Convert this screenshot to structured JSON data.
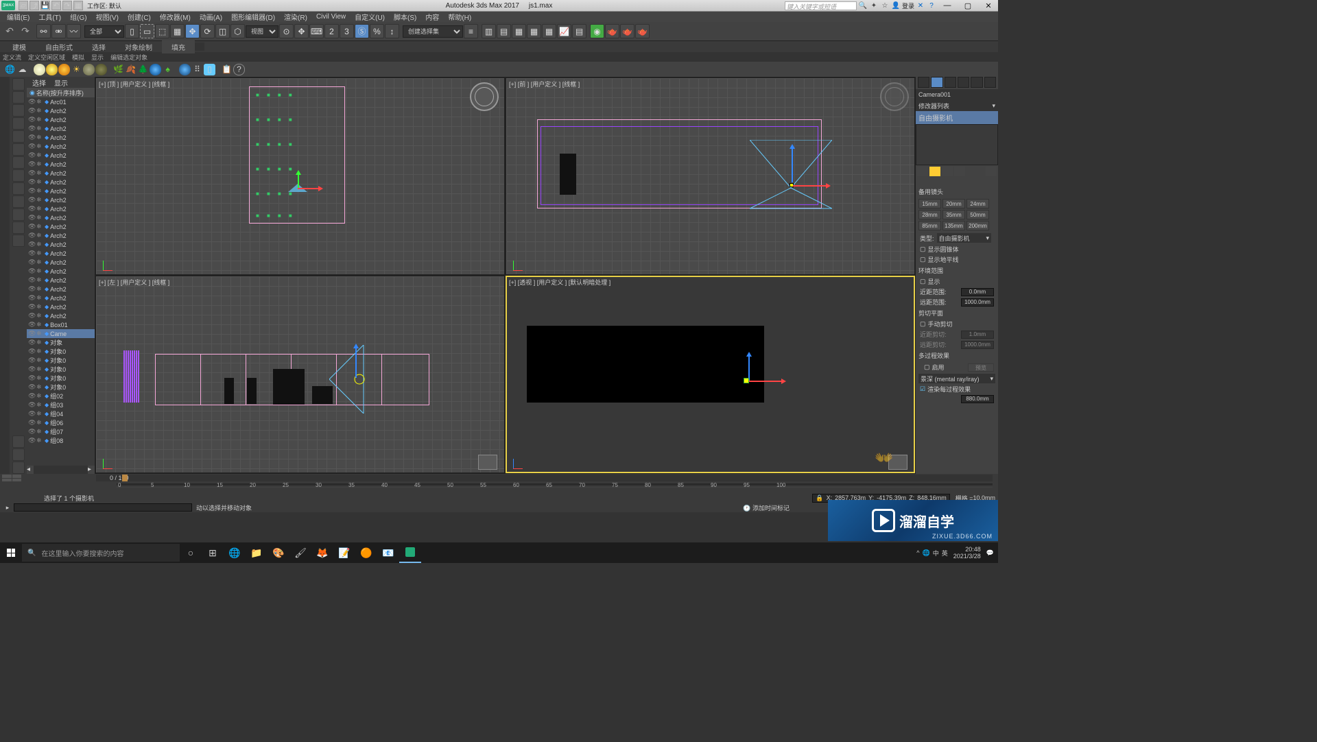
{
  "title_bar": {
    "app": "Autodesk 3ds Max 2017",
    "file": "js1.max",
    "workspace_label": "工作区: 默认",
    "login": "登录",
    "search_placeholder": "键入关键字或短语"
  },
  "menus": [
    "编辑(E)",
    "工具(T)",
    "组(G)",
    "视图(V)",
    "创建(C)",
    "修改器(M)",
    "动画(A)",
    "图形编辑器(D)",
    "渲染(R)",
    "Civil View",
    "自定义(U)",
    "脚本(S)",
    "内容",
    "帮助(H)"
  ],
  "main_toolbar": {
    "filter_all": "全部",
    "ref_sys": "视图",
    "create_sel_set": "创建选择集"
  },
  "ribbon_tabs": [
    "建模",
    "自由形式",
    "选择",
    "对象绘制",
    "填充"
  ],
  "sub_ribbon": [
    "定义流",
    "定义空闲区域",
    "模拟",
    "显示",
    "编辑选定对象"
  ],
  "scene_explorer": {
    "tab1": "选择",
    "tab2": "显示",
    "header": "名称(按升序排序)",
    "items": [
      "Arc01",
      "Arch2",
      "Arch2",
      "Arch2",
      "Arch2",
      "Arch2",
      "Arch2",
      "Arch2",
      "Arch2",
      "Arch2",
      "Arch2",
      "Arch2",
      "Arch2",
      "Arch2",
      "Arch2",
      "Arch2",
      "Arch2",
      "Arch2",
      "Arch2",
      "Arch2",
      "Arch2",
      "Arch2",
      "Arch2",
      "Arch2",
      "Arch2",
      "Box01",
      "Came",
      "对象",
      "对象0",
      "对象0",
      "对象0",
      "对象0",
      "对象0",
      "组02",
      "组03",
      "组04",
      "组06",
      "组07",
      "组08"
    ],
    "selected_index": 26
  },
  "viewports": {
    "top": "[+] [顶 ] [用户定义 ] [线框 ]",
    "front": "[+] [前 ] [用户定义 ] [线框 ]",
    "left": "[+] [左 ] [用户定义 ] [线框 ]",
    "persp": "[+] [透视 ] [用户定义 ] [默认明暗处理 ]"
  },
  "right_panel": {
    "object_name": "Camera001",
    "mod_list_label": "修改器列表",
    "modifier": "自由摄影机",
    "sect_lens": "备用镜头",
    "lenses": [
      "15mm",
      "20mm",
      "24mm",
      "28mm",
      "35mm",
      "50mm",
      "85mm",
      "135mm",
      "200mm"
    ],
    "type_label": "类型:",
    "type_value": "自由摄影机",
    "chk_cone": "显示圆锥体",
    "chk_horizon": "显示地平线",
    "sect_env": "环境范围",
    "chk_show": "显示",
    "near_label": "近距范围:",
    "near_value": "0.0mm",
    "far_label": "远距范围:",
    "far_value": "1000.0mm",
    "sect_clip": "剪切平面",
    "chk_manual": "手动剪切",
    "clip_near_label": "近距剪切:",
    "clip_near_value": "1.0mm",
    "clip_far_label": "远距剪切:",
    "clip_far_value": "1000.0mm",
    "sect_multi": "多过程效果",
    "chk_enable": "启用",
    "preview_btn": "预览",
    "effect_dd": "景深 (mental ray/iray)",
    "chk_render": "渲染每过程效果",
    "tgt_dist": "880.0mm"
  },
  "timeline": {
    "pos": "0 / 100",
    "ticks": [
      0,
      5,
      10,
      15,
      20,
      25,
      30,
      35,
      40,
      45,
      50,
      55,
      60,
      65,
      70,
      75,
      80,
      85,
      90,
      95,
      100
    ]
  },
  "status": {
    "sel_msg": "选择了 1 个摄影机",
    "x_lbl": "X:",
    "x": "2857.763m",
    "y_lbl": "Y:",
    "y": "-4175.39m",
    "z_lbl": "Z:",
    "z": "848.16mm",
    "grid_lbl": "栅格 =",
    "grid": "10.0mm",
    "add_key": "添加时间标记",
    "prompt": "动以选择并移动对象"
  },
  "watermark": {
    "title": "溜溜自学",
    "sub": "ZIXUE.3D66.COM"
  },
  "taskbar": {
    "search": "在这里输入你要搜索的内容",
    "time": "20:48",
    "date": "2021/3/28",
    "ime1": "中",
    "ime2": "英"
  }
}
